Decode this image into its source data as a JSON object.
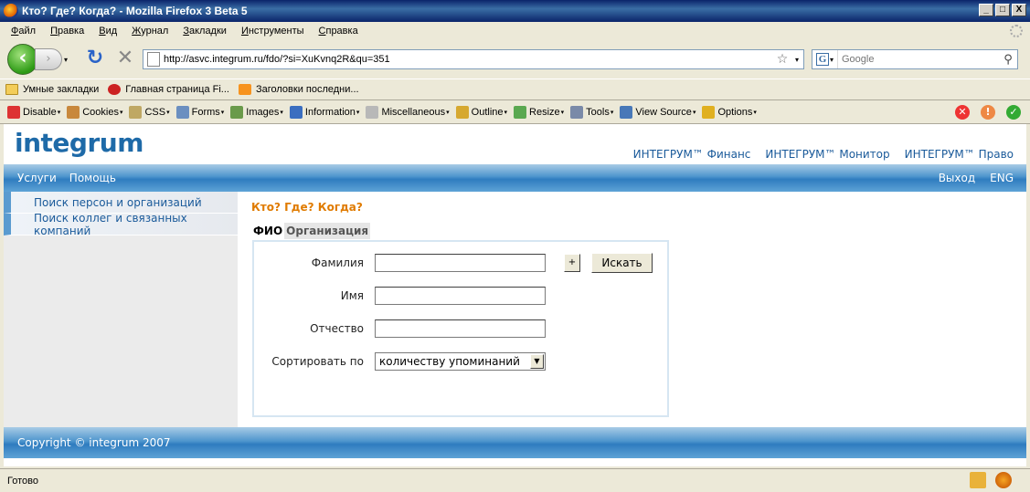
{
  "window": {
    "title": "Кто? Где? Когда? - Mozilla Firefox 3 Beta 5",
    "minimize": "_",
    "maximize": "□",
    "close": "X"
  },
  "menu": [
    "Файл",
    "Правка",
    "Вид",
    "Журнал",
    "Закладки",
    "Инструменты",
    "Справка"
  ],
  "nav": {
    "url": "http://asvc.integrum.ru/fdo/?si=XuKvnq2R&qu=351",
    "search_placeholder": "Google",
    "back_glyph": "‹",
    "forward_glyph": "›",
    "reload_glyph": "↻",
    "stop_glyph": "✕",
    "star_glyph": "☆",
    "search_glyph": "⚲",
    "engine_glyph": "G",
    "dropdown_glyph": "▾"
  },
  "bookmarks": [
    {
      "label": "Умные закладки",
      "icon": "folder-icon"
    },
    {
      "label": "Главная страница Fi...",
      "icon": "favorite-icon"
    },
    {
      "label": "Заголовки последни...",
      "icon": "rss-icon"
    }
  ],
  "devtoolbar": [
    {
      "label": "Disable",
      "color": "#d33"
    },
    {
      "label": "Cookies",
      "color": "#c8883c"
    },
    {
      "label": "CSS",
      "color": "#bfa864"
    },
    {
      "label": "Forms",
      "color": "#6b8fc0"
    },
    {
      "label": "Images",
      "color": "#6a9a4a"
    },
    {
      "label": "Information",
      "color": "#3b6ec0"
    },
    {
      "label": "Miscellaneous",
      "color": "#b8b8b8"
    },
    {
      "label": "Outline",
      "color": "#d6a830"
    },
    {
      "label": "Resize",
      "color": "#5aa850"
    },
    {
      "label": "Tools",
      "color": "#7a8aa8"
    },
    {
      "label": "View Source",
      "color": "#4878b8"
    },
    {
      "label": "Options",
      "color": "#e0b020"
    }
  ],
  "devstatus": {
    "error": "✕",
    "warning": "!",
    "ok": "✓"
  },
  "page": {
    "logo": "integrum",
    "top_links": [
      "ИНТЕГРУМ™ Финанс",
      "ИНТЕГРУМ™ Монитор",
      "ИНТЕГРУМ™ Право"
    ],
    "nav_left": [
      "Услуги",
      "Помощь"
    ],
    "nav_right": [
      "Выход",
      "ENG"
    ],
    "sidebar": [
      "Поиск персон и организаций",
      "Поиск коллег и связанных компаний"
    ],
    "section_title": "Кто? Где? Когда?",
    "tabs": [
      "ФИО",
      "Организация"
    ],
    "form": {
      "surname_label": "Фамилия",
      "name_label": "Имя",
      "patronymic_label": "Отчество",
      "sort_label": "Сортировать по",
      "sort_value": "количеству упоминаний",
      "plus_label": "+",
      "search_label": "Искать",
      "select_arrow": "▼"
    },
    "footer": "Copyright © integrum 2007"
  },
  "status": "Готово"
}
